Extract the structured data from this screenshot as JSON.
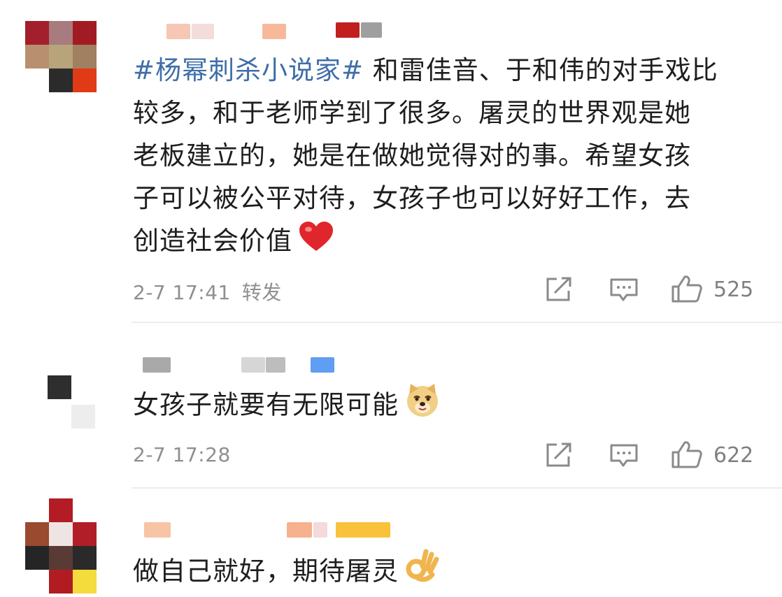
{
  "comments": [
    {
      "hashtag": "#杨幂刺杀小说家#",
      "text": "和雷佳音、于和伟的对手戏比\n较多，和于老师学到了很多。屠灵的世界观是她\n老板建立的，她是在做她觉得对的事。希望女孩\n子可以被公平对待，女孩子也可以好好工作，去\n创造社会价值",
      "emoji": "heart-emoji",
      "time": "2-7 17:41",
      "repost_label": "转发",
      "likes": "525"
    },
    {
      "hashtag": "",
      "text": "女孩子就要有无限可能",
      "emoji": "doge-emoji",
      "time": "2-7 17:28",
      "repost_label": "",
      "likes": "622"
    },
    {
      "hashtag": "",
      "text": "做自己就好，期待屠灵",
      "emoji": "ok-hand-emoji",
      "time": "",
      "repost_label": "",
      "likes": ""
    }
  ],
  "colors": {
    "hashtag": "#3f6ea8",
    "meta_text": "#8f8f8f",
    "icon": "#8a8a8a",
    "divider": "#ececec"
  }
}
